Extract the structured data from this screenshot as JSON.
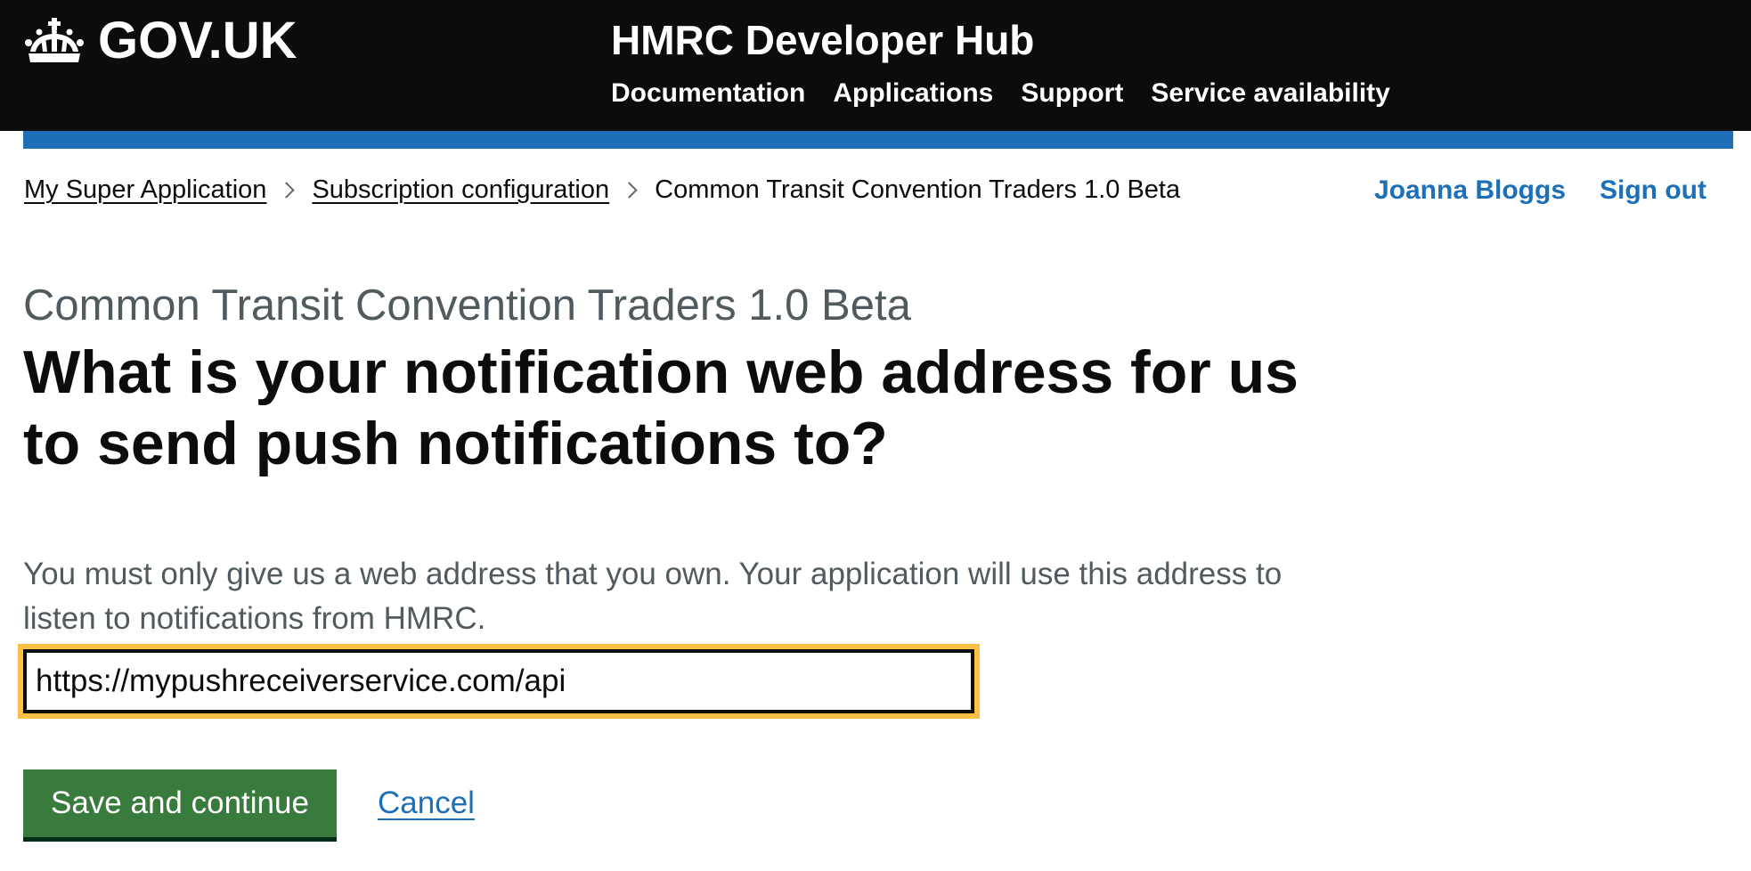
{
  "header": {
    "logo_text": "GOV.UK",
    "service_name": "HMRC Developer Hub",
    "nav": [
      {
        "label": "Documentation"
      },
      {
        "label": "Applications"
      },
      {
        "label": "Support"
      },
      {
        "label": "Service availability"
      }
    ],
    "colors": {
      "background": "#0b0c0c",
      "accent_bar": "#1d70b8"
    }
  },
  "breadcrumbs": {
    "items": [
      {
        "label": "My Super Application"
      },
      {
        "label": "Subscription configuration"
      }
    ],
    "current": "Common Transit Convention Traders 1.0 Beta"
  },
  "user": {
    "name": "Joanna Bloggs",
    "sign_out": "Sign out"
  },
  "page": {
    "caption": "Common Transit Convention Traders 1.0 Beta",
    "heading": "What is your notification web address for us to send push notifications to?",
    "hint": "You must only give us a web address that you own. Your application will use this address to listen to notifications from HMRC.",
    "input_value": "https://mypushreceiverservice.com/api",
    "save_button": "Save and continue",
    "cancel_link": "Cancel",
    "colors": {
      "button": "#397b3c",
      "focus": "#fcbf45",
      "link": "#1d70b8"
    }
  }
}
